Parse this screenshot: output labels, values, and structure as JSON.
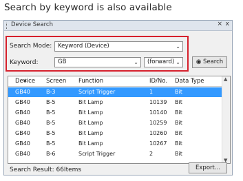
{
  "caption": "Search by keyword is also available",
  "window": {
    "title": "Device Search",
    "pin_glyph": "⨯",
    "close_glyph": "x"
  },
  "search": {
    "mode_label": "Search Mode:",
    "mode_value": "Keyword (Device)",
    "keyword_label": "Keyword:",
    "keyword_value": "GB",
    "direction_value": "(forward)",
    "search_button": "Search"
  },
  "table": {
    "columns": [
      "Device",
      "Screen",
      "Function",
      "ID/No.",
      "Data Type"
    ],
    "rows": [
      [
        "GB40",
        "B-3",
        "Script Trigger",
        "1",
        "Bit"
      ],
      [
        "GB40",
        "B-5",
        "Bit Lamp",
        "10139",
        "Bit"
      ],
      [
        "GB40",
        "B-5",
        "Bit Lamp",
        "10140",
        "Bit"
      ],
      [
        "GB40",
        "B-5",
        "Bit Lamp",
        "10259",
        "Bit"
      ],
      [
        "GB40",
        "B-5",
        "Bit Lamp",
        "10260",
        "Bit"
      ],
      [
        "GB40",
        "B-5",
        "Bit Lamp",
        "10267",
        "Bit"
      ],
      [
        "GB40",
        "B-6",
        "Script Trigger",
        "2",
        "Bit"
      ]
    ],
    "selected_row": 0
  },
  "status": {
    "result": "Search Result: 66Items",
    "export_button": "Export..."
  }
}
